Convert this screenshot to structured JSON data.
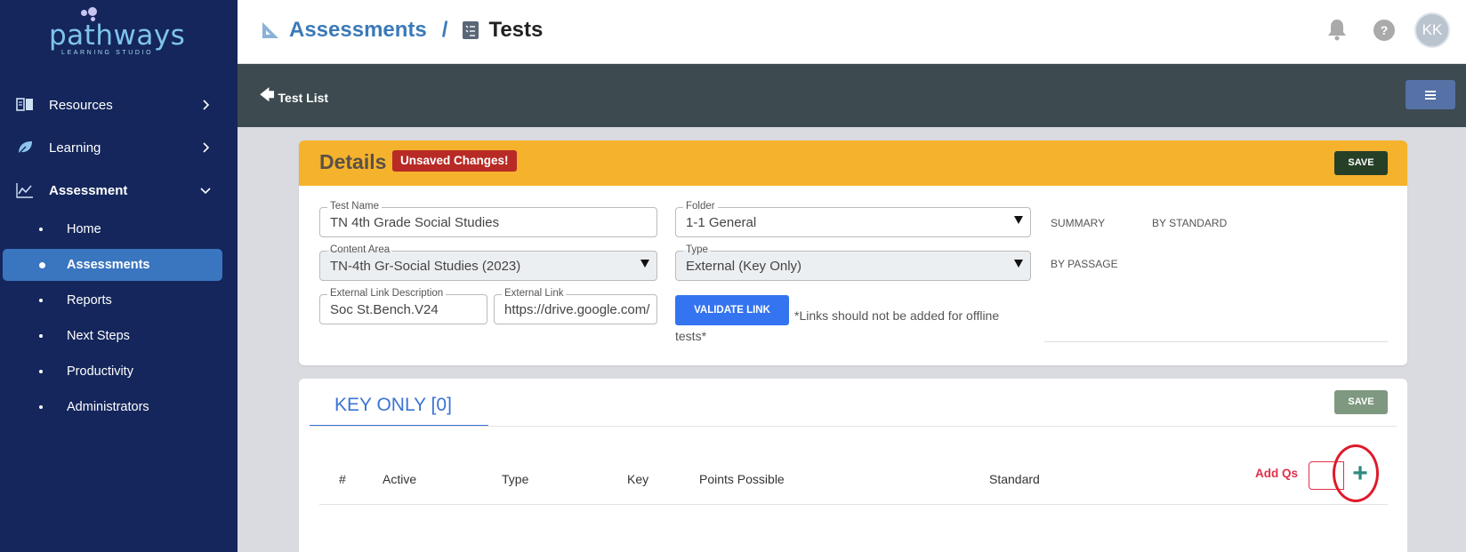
{
  "brand": {
    "name": "pathways",
    "tagline": "LEARNING STUDIO"
  },
  "sidebar": {
    "items": [
      {
        "label": "Resources",
        "icon": "book-icon",
        "expanded": false
      },
      {
        "label": "Learning",
        "icon": "leaf-icon",
        "expanded": false
      },
      {
        "label": "Assessment",
        "icon": "chart-icon",
        "expanded": true
      }
    ],
    "subitems": [
      {
        "label": "Home",
        "active": false
      },
      {
        "label": "Assessments",
        "active": true
      },
      {
        "label": "Reports",
        "active": false
      },
      {
        "label": "Next Steps",
        "active": false
      },
      {
        "label": "Productivity",
        "active": false
      },
      {
        "label": "Administrators",
        "active": false
      }
    ]
  },
  "header": {
    "breadcrumb": {
      "first": "Assessments",
      "separator": "/",
      "current": "Tests"
    },
    "help_glyph": "?",
    "avatar_initials": "KK"
  },
  "subheader": {
    "back_arrow": "🡄",
    "back_label": "Test List"
  },
  "details": {
    "title": "Details",
    "unsaved_badge": "Unsaved Changes!",
    "save_label": "SAVE",
    "fields": {
      "test_name": {
        "label": "Test Name",
        "value": "TN 4th Grade Social Studies"
      },
      "folder": {
        "label": "Folder",
        "value": "1-1 General"
      },
      "content_area": {
        "label": "Content Area",
        "value": "TN-4th Gr-Social Studies (2023)"
      },
      "type": {
        "label": "Type",
        "value": "External (Key Only)"
      },
      "ext_link_desc": {
        "label": "External Link Description",
        "value": "Soc St.Bench.V24"
      },
      "ext_link": {
        "label": "External Link",
        "value": "https://drive.google.com/"
      }
    },
    "validate_label": "VALIDATE LINK",
    "validate_note": "*Links should not be added for offline tests*",
    "summary_tabs": [
      "SUMMARY",
      "BY STANDARD",
      "BY PASSAGE"
    ]
  },
  "key_only": {
    "tab_label": "KEY ONLY [0]",
    "save_label": "SAVE",
    "columns": [
      "#",
      "Active",
      "Type",
      "Key",
      "Points Possible",
      "Standard"
    ],
    "add_qs_label": "Add Qs",
    "add_qs_value": "",
    "add_glyph": "+"
  },
  "colors": {
    "sidebar_bg": "#14265b",
    "active_item": "#3a75c0",
    "details_header": "#f5b22d",
    "unsaved_badge": "#b82a25",
    "validate_button": "#3474f1",
    "add_accent": "#e0304a"
  }
}
